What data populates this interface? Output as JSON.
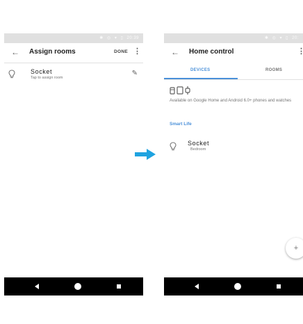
{
  "left_screen": {
    "status_time": "20:39",
    "title": "Assign rooms",
    "done_label": "DONE",
    "device": {
      "name": "Socket",
      "subtitle": "Tap to assign room"
    }
  },
  "right_screen": {
    "status_time": "20:",
    "title": "Home control",
    "tabs": [
      {
        "label": "DEVICES",
        "active": true
      },
      {
        "label": "ROOMS",
        "active": false
      }
    ],
    "availability_text": "Available on Google Home and Android 6.0+ phones and watches",
    "section_label": "Smart Life",
    "device": {
      "name": "Socket",
      "room": "Bedroom"
    },
    "fab_label": "+"
  },
  "colors": {
    "accent": "#4a90d9",
    "arrow": "#1fa3e0",
    "navbar": "#000000",
    "statusbar": "#e0e0e0"
  },
  "icons": [
    "back-arrow-icon",
    "more-vert-icon",
    "bulb-icon",
    "pencil-icon",
    "phone-icon",
    "tablet-icon",
    "watch-icon",
    "add-icon",
    "nav-back-icon",
    "nav-home-icon",
    "nav-recent-icon",
    "transition-arrow-icon"
  ]
}
